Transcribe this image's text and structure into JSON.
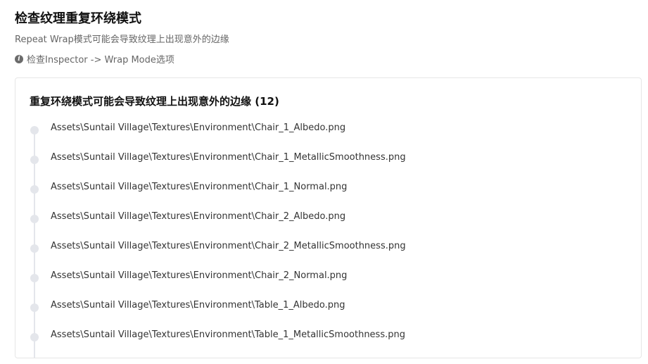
{
  "header": {
    "title": "检查纹理重复环绕模式",
    "subtitle": "Repeat Wrap模式可能会导致纹理上出现意外的边缘",
    "hint_icon": "info-circle-icon",
    "hint_text": "检查Inspector -> Wrap Mode选项"
  },
  "card": {
    "title": "重复环绕模式可能会导致纹理上出现意外的边缘 (12)",
    "items": [
      "Assets\\Suntail Village\\Textures\\Environment\\Chair_1_Albedo.png",
      "Assets\\Suntail Village\\Textures\\Environment\\Chair_1_MetallicSmoothness.png",
      "Assets\\Suntail Village\\Textures\\Environment\\Chair_1_Normal.png",
      "Assets\\Suntail Village\\Textures\\Environment\\Chair_2_Albedo.png",
      "Assets\\Suntail Village\\Textures\\Environment\\Chair_2_MetallicSmoothness.png",
      "Assets\\Suntail Village\\Textures\\Environment\\Chair_2_Normal.png",
      "Assets\\Suntail Village\\Textures\\Environment\\Table_1_Albedo.png",
      "Assets\\Suntail Village\\Textures\\Environment\\Table_1_MetallicSmoothness.png"
    ]
  },
  "colors": {
    "timeline": "#e4e6eb",
    "title_text": "#111111",
    "muted_text": "#666666"
  }
}
